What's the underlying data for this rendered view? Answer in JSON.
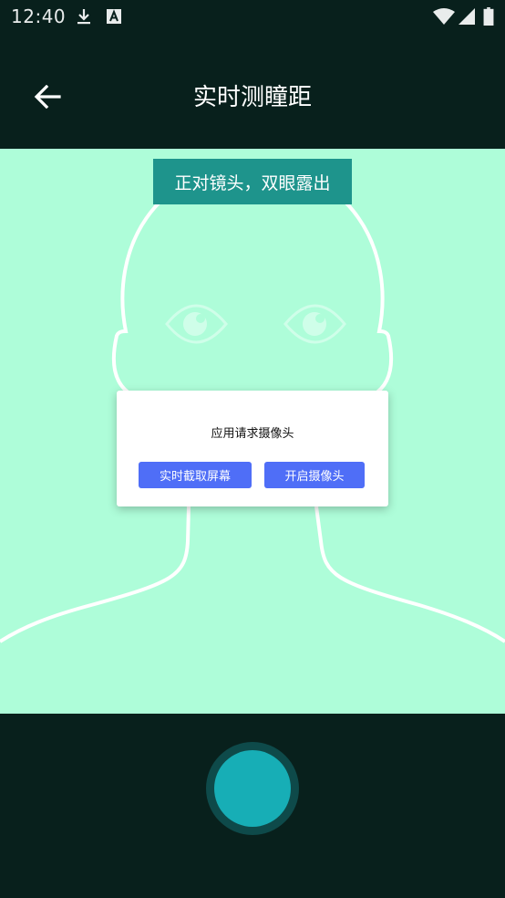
{
  "status_bar": {
    "time": "12:40",
    "icons": [
      "download-icon",
      "a-icon",
      "wifi-icon",
      "signal-icon",
      "battery-icon"
    ]
  },
  "app_bar": {
    "title": "实时测瞳距",
    "back_icon": "arrow-left-icon"
  },
  "camera": {
    "hint": "正对镜头，双眼露出",
    "background_color": "#aefdd9"
  },
  "dialog": {
    "message": "应用请求摄像头",
    "screen_capture_label": "实时截取屏幕",
    "open_camera_label": "开启摄像头"
  },
  "bottom": {
    "shutter_icon": "shutter-icon"
  }
}
